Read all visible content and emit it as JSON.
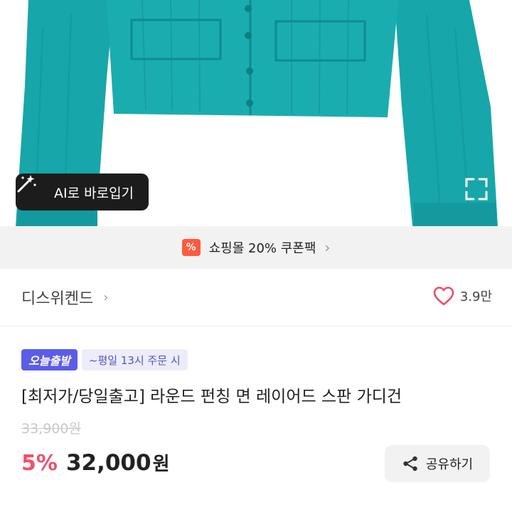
{
  "colors": {
    "product": "#17a6aa",
    "coupon_badge": "#ff5a3c",
    "today_badge": "#5b5ce8",
    "discount": "#f0506e",
    "heart": "#e8506a"
  },
  "ai_button": {
    "icon": "magic-wand-icon",
    "label": "AI로 바로입기"
  },
  "expand_icon": "expand-icon",
  "coupon": {
    "icon": "percent-coupon-icon",
    "badge_glyph": "%",
    "label": "쇼핑몰 20% 쿠폰팩"
  },
  "shop": {
    "name": "디스위켄드",
    "likes": "3.9만"
  },
  "delivery": {
    "badge": "오늘출발",
    "note": "~평일 13시 주문 시"
  },
  "product": {
    "title": "[최저가/당일출고] 라운드 펀칭 면 레이어드 스판 가디건",
    "original_price": "33,900원",
    "discount": "5%",
    "price": "32,000",
    "currency": "원"
  },
  "share": {
    "label": "공유하기",
    "icon": "share-icon"
  }
}
